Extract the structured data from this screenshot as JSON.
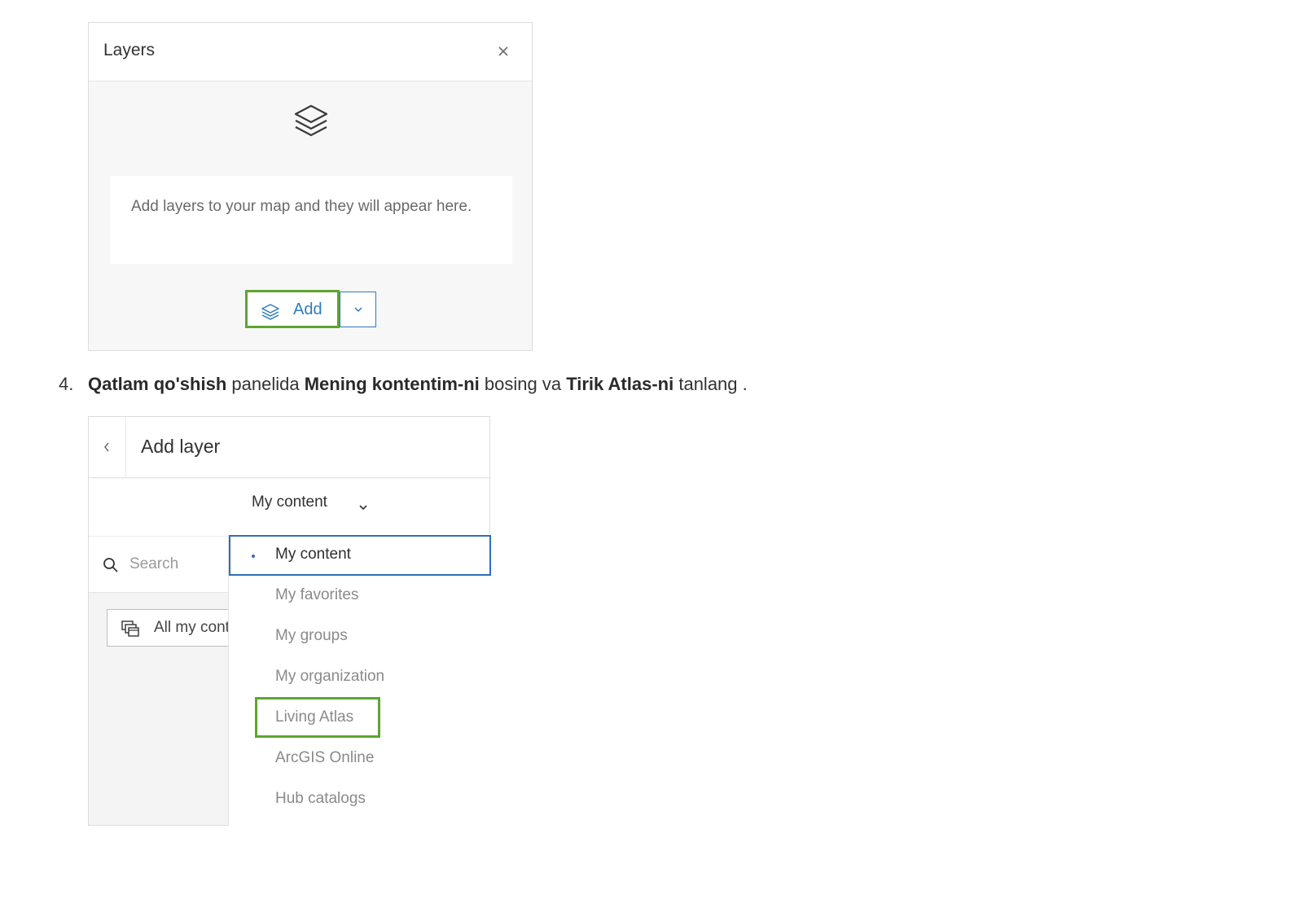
{
  "layers_panel": {
    "title": "Layers",
    "empty_message": "Add layers to your map and they will appear here.",
    "add_button_label": "Add",
    "icons": {
      "close": "close-icon",
      "layers": "layers-stack-icon",
      "add": "add-layer-icon",
      "dropdown": "chevron-down-icon"
    }
  },
  "instruction": {
    "number": "4.",
    "part1_bold": "Qatlam qo'shish",
    "part2": " panelida ",
    "part3_bold": "Mening kontentim-ni",
    "part4": " bosing va ",
    "part5_bold": "Tirik Atlas-ni",
    "part6": " tanlang ."
  },
  "add_layer_panel": {
    "title": "Add layer",
    "source_selected": "My content",
    "search_placeholder": "Search",
    "filter_label": "All my content",
    "menu_items": [
      {
        "label": "My content",
        "selected": true
      },
      {
        "label": "My favorites",
        "selected": false
      },
      {
        "label": "My groups",
        "selected": false
      },
      {
        "label": "My organization",
        "selected": false
      },
      {
        "label": "Living Atlas",
        "selected": false,
        "highlighted": true
      },
      {
        "label": "ArcGIS Online",
        "selected": false
      },
      {
        "label": "Hub catalogs",
        "selected": false
      }
    ],
    "colors": {
      "highlight": "#5ea52f",
      "accent": "#2d7bc2",
      "selected_border": "#2e6fb7"
    }
  }
}
